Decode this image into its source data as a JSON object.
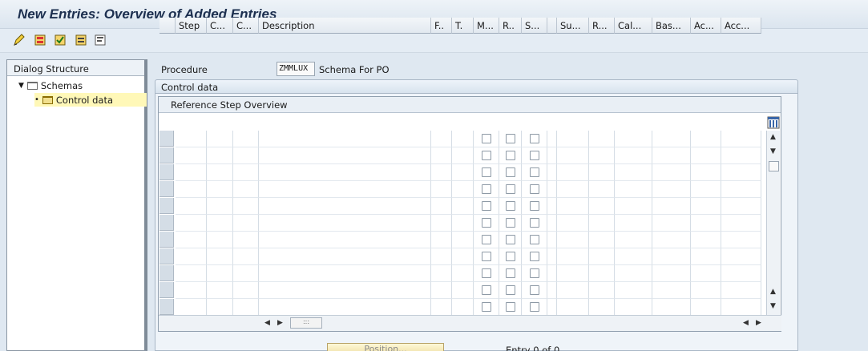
{
  "window": {
    "title": "New Entries: Overview of Added Entries"
  },
  "toolbar": {
    "icons": [
      "change-display-icon",
      "save-icon",
      "select-all-icon",
      "deselect-icon",
      "details-icon"
    ]
  },
  "dialog_structure": {
    "header": "Dialog Structure",
    "items": [
      {
        "label": "Schemas",
        "expanded": true,
        "icon": "folder-icon"
      },
      {
        "label": "Control data",
        "selected": true,
        "icon": "open-folder-icon"
      }
    ]
  },
  "procedure": {
    "label": "Procedure",
    "value": "ZMMLUX",
    "description": "Schema For PO"
  },
  "control_data": {
    "tab_label": "Control data",
    "table_title": "Reference Step Overview",
    "columns": [
      "Step",
      "C...",
      "C...",
      "Description",
      "F..",
      "T.",
      "M...",
      "R..",
      "S...",
      "",
      "Su...",
      "R...",
      "Cal...",
      "Bas...",
      "Ac...",
      "Acc..."
    ],
    "row_count": 11
  },
  "footer": {
    "position_button": "Position...",
    "entry_text": "Entry 0 of 0"
  },
  "colors": {
    "title": "#1c2f4f",
    "selected": "#fff8b8"
  }
}
